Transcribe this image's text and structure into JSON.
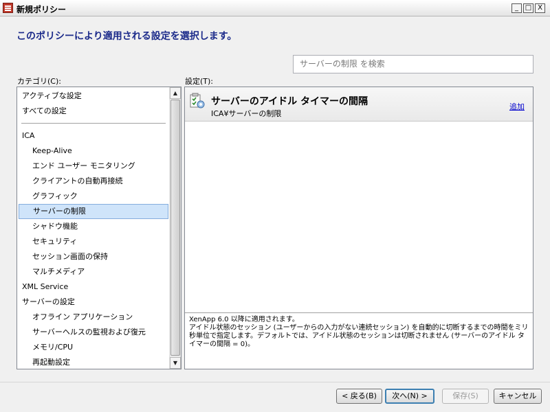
{
  "window": {
    "title": "新規ポリシー",
    "controls": {
      "minimize": "_",
      "maximize": "□",
      "close": "X"
    }
  },
  "heading": "このポリシーにより適用される設定を選択します。",
  "search": {
    "placeholder": "サーバーの制限 を検索"
  },
  "categories": {
    "label": "カテゴリ(C):",
    "items": [
      "アクティブな設定",
      "すべての設定",
      "ICA",
      "Keep-Alive",
      "エンド ユーザー モニタリング",
      "クライアントの自動再接続",
      "グラフィック",
      "サーバーの制限",
      "シャドウ機能",
      "セキュリティ",
      "セッション画面の保持",
      "マルチメディア",
      "XML Service",
      "サーバーの設定",
      "オフライン アプリケーション",
      "サーバーヘルスの監視および復元",
      "メモリ/CPU",
      "再起動設定"
    ],
    "selected": "サーバーの制限"
  },
  "scrollbar": {
    "up": "▲",
    "down": "▼"
  },
  "settings": {
    "label": "設定(T):",
    "item": {
      "title": "サーバーのアイドル タイマーの間隔",
      "path": "ICA¥サーバーの制限",
      "add_label": "追加"
    },
    "description": {
      "line1": "XenApp 6.0 以降に適用されます。",
      "line2": "アイドル状態のセッション (ユーザーからの入力がない連続セッション) を自動的に切断するまでの時間をミリ秒単位で指定します。デフォルトでは、アイドル状態のセッションは切断されません (サーバーのアイドル タイマーの間隔 = 0)。"
    }
  },
  "buttons": {
    "back": "< 戻る(B)",
    "next": "次へ(N) >",
    "save": "保存(S)",
    "cancel": "キャンセル"
  }
}
